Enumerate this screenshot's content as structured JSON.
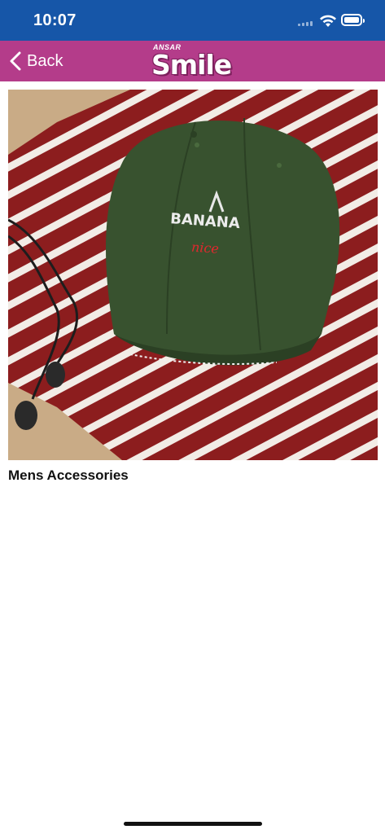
{
  "status_bar": {
    "time": "10:07"
  },
  "nav": {
    "back_label": "Back",
    "logo_small": "ANSAR",
    "logo_big": "Smile",
    "background_color": "#b43c8a"
  },
  "product": {
    "image_text_main": "BANANA",
    "image_text_script": "nice",
    "title": "Mens Accessories"
  },
  "colors": {
    "status_bar": "#1656a8",
    "shirt": "#8c1d1e",
    "cap": "#38522f"
  }
}
